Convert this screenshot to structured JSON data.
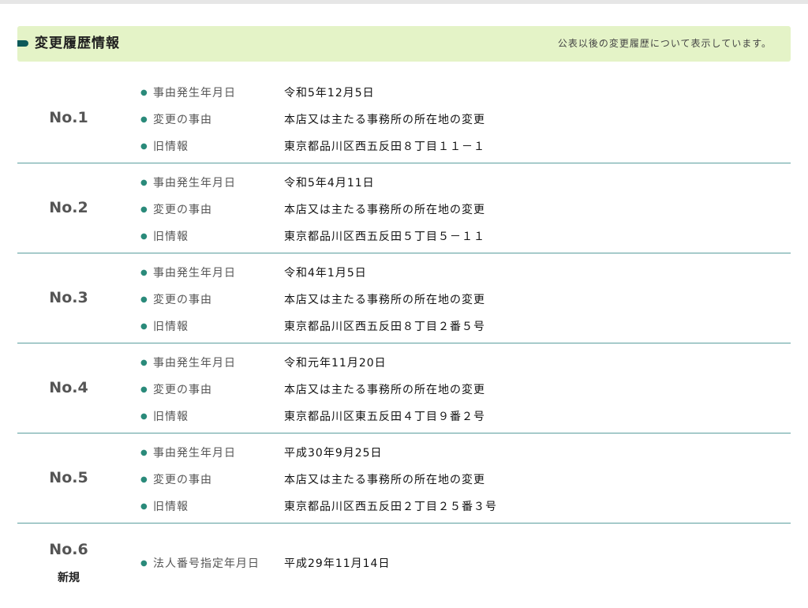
{
  "header": {
    "title": "変更履歴情報",
    "note": "公表以後の変更履歴について表示しています。"
  },
  "colors": {
    "header_bg": "#e4f3c7",
    "accent": "#0d5a5a",
    "divider": "#5a9e9e"
  },
  "entries": [
    {
      "no": "No.1",
      "sub": "",
      "rows": [
        {
          "label": "事由発生年月日",
          "value": "令和5年12月5日"
        },
        {
          "label": "変更の事由",
          "value": "本店又は主たる事務所の所在地の変更"
        },
        {
          "label": "旧情報",
          "value": "東京都品川区西五反田８丁目１１－１"
        }
      ]
    },
    {
      "no": "No.2",
      "sub": "",
      "rows": [
        {
          "label": "事由発生年月日",
          "value": "令和5年4月11日"
        },
        {
          "label": "変更の事由",
          "value": "本店又は主たる事務所の所在地の変更"
        },
        {
          "label": "旧情報",
          "value": "東京都品川区西五反田５丁目５－１１"
        }
      ]
    },
    {
      "no": "No.3",
      "sub": "",
      "rows": [
        {
          "label": "事由発生年月日",
          "value": "令和4年1月5日"
        },
        {
          "label": "変更の事由",
          "value": "本店又は主たる事務所の所在地の変更"
        },
        {
          "label": "旧情報",
          "value": "東京都品川区西五反田８丁目２番５号"
        }
      ]
    },
    {
      "no": "No.4",
      "sub": "",
      "rows": [
        {
          "label": "事由発生年月日",
          "value": "令和元年11月20日"
        },
        {
          "label": "変更の事由",
          "value": "本店又は主たる事務所の所在地の変更"
        },
        {
          "label": "旧情報",
          "value": "東京都品川区東五反田４丁目９番２号"
        }
      ]
    },
    {
      "no": "No.5",
      "sub": "",
      "rows": [
        {
          "label": "事由発生年月日",
          "value": "平成30年9月25日"
        },
        {
          "label": "変更の事由",
          "value": "本店又は主たる事務所の所在地の変更"
        },
        {
          "label": "旧情報",
          "value": "東京都品川区西五反田２丁目２５番３号"
        }
      ]
    },
    {
      "no": "No.6",
      "sub": "新規",
      "rows": [
        {
          "label": "法人番号指定年月日",
          "value": "平成29年11月14日"
        }
      ]
    }
  ]
}
